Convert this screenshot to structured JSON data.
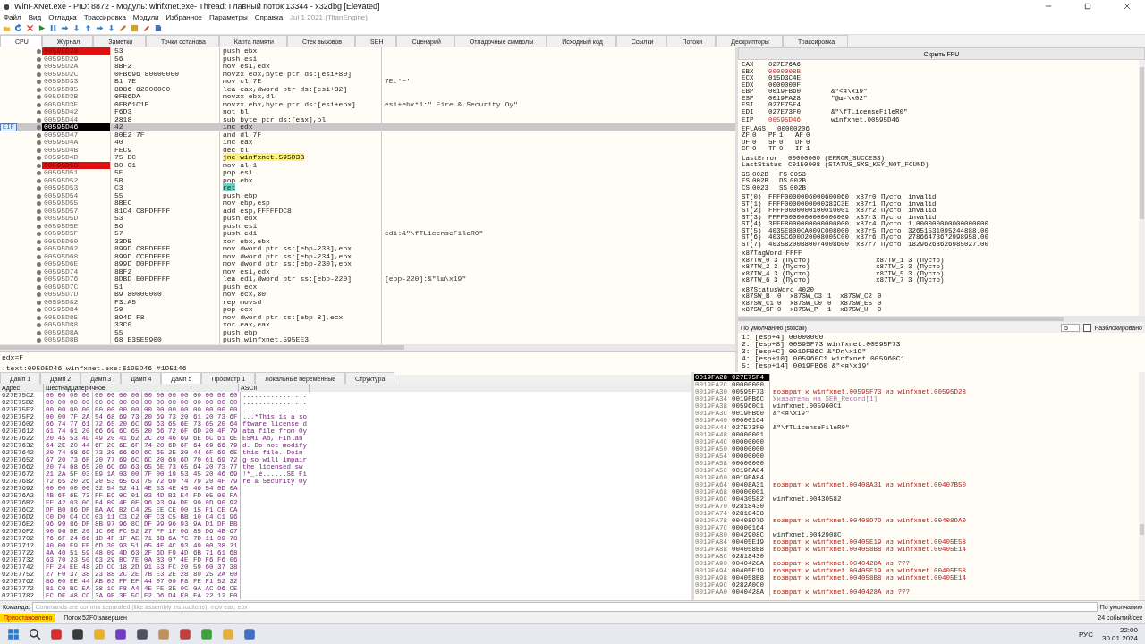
{
  "window": {
    "title": "WinFXNet.exe - PID: 8872 - Модуль: winfxnet.exe- Thread: Главный поток 13344 - x32dbg [Elevated]"
  },
  "menu": [
    "Файл",
    "Вид",
    "Отладка",
    "Трассировка",
    "Модули",
    "Избранное",
    "Параметры",
    "Справка"
  ],
  "build_info": "Jul 1 2021 (TitanEngine)",
  "tabs": [
    {
      "label": "CPU",
      "selected": true
    },
    {
      "label": "Журнал",
      "selected": false
    },
    {
      "label": "Заметки",
      "selected": false
    },
    {
      "label": "Точки останова",
      "selected": false
    },
    {
      "label": "Карта памяти",
      "selected": false
    },
    {
      "label": "Стек вызовов",
      "selected": false
    },
    {
      "label": "SEH",
      "selected": false
    },
    {
      "label": "Сценарий",
      "selected": false
    },
    {
      "label": "Отладочные символы",
      "selected": false
    },
    {
      "label": "Исходный код",
      "selected": false
    },
    {
      "label": "Ссылки",
      "selected": false
    },
    {
      "label": "Потоки",
      "selected": false
    },
    {
      "label": "Дескрипторы",
      "selected": false
    },
    {
      "label": "Трассировка",
      "selected": false
    }
  ],
  "disassembly": {
    "eip_label": "EIP",
    "rows": [
      {
        "address": "00595D28",
        "bytes": "53",
        "instruction": "push ebx",
        "breakpoint": true,
        "current": false,
        "kind": "plain"
      },
      {
        "address": "00595D29",
        "bytes": "56",
        "instruction": "push esi",
        "breakpoint": false,
        "current": false,
        "kind": "plain"
      },
      {
        "address": "00595D2A",
        "bytes": "8BF2",
        "instruction": "mov esi,edx",
        "breakpoint": false,
        "current": false,
        "kind": "plain"
      },
      {
        "address": "00595D2C",
        "bytes": "0FB696 80000000",
        "instruction": "movzx edx,byte ptr ds:[esi+80]",
        "breakpoint": false,
        "current": false,
        "kind": "plain"
      },
      {
        "address": "00595D33",
        "bytes": "B1 7E",
        "instruction": "mov cl,7E",
        "comment": "7E:'~'",
        "breakpoint": false,
        "current": false,
        "kind": "plain"
      },
      {
        "address": "00595D35",
        "bytes": "8D86 82000000",
        "instruction": "lea eax,dword ptr ds:[esi+82]",
        "breakpoint": false,
        "current": false,
        "kind": "plain"
      },
      {
        "address": "00595D3B",
        "bytes": "0FB6DA",
        "instruction": "movzx ebx,dl",
        "breakpoint": false,
        "current": false,
        "kind": "plain"
      },
      {
        "address": "00595D3E",
        "bytes": "0FB61C1E",
        "instruction": "movzx ebx,byte ptr ds:[esi+ebx]",
        "comment": "esi+ebx*1:\" Fire & Security Oy\"",
        "breakpoint": false,
        "current": false,
        "kind": "plain"
      },
      {
        "address": "00595D42",
        "bytes": "F6D3",
        "instruction": "not bl",
        "breakpoint": false,
        "current": false,
        "kind": "plain"
      },
      {
        "address": "00595D44",
        "bytes": "2818",
        "instruction": "sub byte ptr ds:[eax],bl",
        "breakpoint": false,
        "current": false,
        "kind": "plain"
      },
      {
        "address": "00595D46",
        "bytes": "42",
        "instruction": "inc edx",
        "breakpoint": false,
        "current": true,
        "kind": "plain"
      },
      {
        "address": "00595D47",
        "bytes": "80E2 7F",
        "instruction": "and dl,7F",
        "breakpoint": false,
        "current": false,
        "kind": "plain"
      },
      {
        "address": "00595D4A",
        "bytes": "40",
        "instruction": "inc eax",
        "breakpoint": false,
        "current": false,
        "kind": "plain"
      },
      {
        "address": "00595D4B",
        "bytes": "FEC9",
        "instruction": "dec cl",
        "breakpoint": false,
        "current": false,
        "kind": "plain"
      },
      {
        "address": "00595D4D",
        "bytes": "75 EC",
        "instruction": "jne winfxnet.595D3B",
        "breakpoint": false,
        "current": false,
        "kind": "jump"
      },
      {
        "address": "00595D50",
        "bytes": "B0 01",
        "instruction": "mov al,1",
        "breakpoint": true,
        "current": false,
        "kind": "plain"
      },
      {
        "address": "00595D51",
        "bytes": "5E",
        "instruction": "pop esi",
        "breakpoint": false,
        "current": false,
        "kind": "plain"
      },
      {
        "address": "00595D52",
        "bytes": "5B",
        "instruction": "pop ebx",
        "breakpoint": false,
        "current": false,
        "kind": "plain"
      },
      {
        "address": "00595D53",
        "bytes": "C3",
        "instruction": "ret",
        "breakpoint": false,
        "current": false,
        "kind": "ret"
      },
      {
        "address": "00595D54",
        "bytes": "55",
        "instruction": "push ebp",
        "breakpoint": false,
        "current": false,
        "kind": "plain"
      },
      {
        "address": "00595D55",
        "bytes": "8BEC",
        "instruction": "mov ebp,esp",
        "breakpoint": false,
        "current": false,
        "kind": "plain"
      },
      {
        "address": "00595D57",
        "bytes": "81C4 C8FDFFFF",
        "instruction": "add esp,FFFFFDC8",
        "breakpoint": false,
        "current": false,
        "kind": "plain"
      },
      {
        "address": "00595D5D",
        "bytes": "53",
        "instruction": "push ebx",
        "breakpoint": false,
        "current": false,
        "kind": "plain"
      },
      {
        "address": "00595D5E",
        "bytes": "56",
        "instruction": "push esi",
        "breakpoint": false,
        "current": false,
        "kind": "plain"
      },
      {
        "address": "00595D5F",
        "bytes": "57",
        "instruction": "push edi",
        "comment": "edi:&\"\\fTLicenseFileR0\"",
        "breakpoint": false,
        "current": false,
        "kind": "plain"
      },
      {
        "address": "00595D60",
        "bytes": "33DB",
        "instruction": "xor ebx,ebx",
        "breakpoint": false,
        "current": false,
        "kind": "plain"
      },
      {
        "address": "00595D62",
        "bytes": "899D C8FDFFFF",
        "instruction": "mov dword ptr ss:[ebp-238],ebx",
        "breakpoint": false,
        "current": false,
        "kind": "plain"
      },
      {
        "address": "00595D68",
        "bytes": "899D CCFDFFFF",
        "instruction": "mov dword ptr ss:[ebp-234],ebx",
        "breakpoint": false,
        "current": false,
        "kind": "plain"
      },
      {
        "address": "00595D6E",
        "bytes": "899D D0FDFFFF",
        "instruction": "mov dword ptr ss:[ebp-230],ebx",
        "breakpoint": false,
        "current": false,
        "kind": "plain"
      },
      {
        "address": "00595D74",
        "bytes": "8BF2",
        "instruction": "mov esi,edx",
        "breakpoint": false,
        "current": false,
        "kind": "plain"
      },
      {
        "address": "00595D76",
        "bytes": "8DBD E0FDFFFF",
        "instruction": "lea edi,dword ptr ss:[ebp-220]",
        "comment": "[ebp-220]:&\"lш\\x19\"",
        "breakpoint": false,
        "current": false,
        "kind": "plain"
      },
      {
        "address": "00595D7C",
        "bytes": "51",
        "instruction": "push ecx",
        "breakpoint": false,
        "current": false,
        "kind": "plain"
      },
      {
        "address": "00595D7D",
        "bytes": "B9 80000000",
        "instruction": "mov ecx,80",
        "breakpoint": false,
        "current": false,
        "kind": "plain"
      },
      {
        "address": "00595D82",
        "bytes": "F3:A5",
        "instruction": "rep movsd",
        "breakpoint": false,
        "current": false,
        "kind": "plain"
      },
      {
        "address": "00595D84",
        "bytes": "59",
        "instruction": "pop ecx",
        "breakpoint": false,
        "current": false,
        "kind": "plain"
      },
      {
        "address": "00595D85",
        "bytes": "894D F8",
        "instruction": "mov dword ptr ss:[ebp-8],ecx",
        "breakpoint": false,
        "current": false,
        "kind": "plain"
      },
      {
        "address": "00595D88",
        "bytes": "33C0",
        "instruction": "xor eax,eax",
        "breakpoint": false,
        "current": false,
        "kind": "plain"
      },
      {
        "address": "00595D8A",
        "bytes": "55",
        "instruction": "push ebp",
        "breakpoint": false,
        "current": false,
        "kind": "plain"
      },
      {
        "address": "00595D8B",
        "bytes": "68 E35E5900",
        "instruction": "push winfxnet.595EE3",
        "breakpoint": false,
        "current": false,
        "kind": "plain"
      }
    ]
  },
  "info_lines": [
    "edx=F",
    ".text:00595D46 winfxnet.exe:$195D46 #195146"
  ],
  "registers": {
    "hide_fpu": "Скрыть FPU",
    "general": [
      {
        "name": "EAX",
        "value": "027E76A6",
        "changed": false
      },
      {
        "name": "EBX",
        "value": "0000008B",
        "changed": true
      },
      {
        "name": "ECX",
        "value": "015D3C4E",
        "changed": false
      },
      {
        "name": "EDX",
        "value": "0000000F",
        "changed": false
      },
      {
        "name": "EBP",
        "value": "0019FB60",
        "comment": "&\"<я\\x19\"",
        "changed": false
      },
      {
        "name": "ESP",
        "value": "0019FA28",
        "comment": "\"@ш-\\x02\"",
        "changed": false
      },
      {
        "name": "ESI",
        "value": "027E75F4",
        "changed": false
      },
      {
        "name": "EDI",
        "value": "027E73F0",
        "comment": "&\"\\fTLicenseFileR0\"",
        "changed": false
      }
    ],
    "eip": {
      "name": "EIP",
      "value": "00595D46",
      "comment": "winfxnet.00595D46",
      "changed": true
    },
    "blocks": [
      {
        "kind": "flags",
        "lines": [
          [
            "EFLAGS",
            "00000206"
          ],
          [
            "ZF",
            "0",
            "PF",
            "1",
            "AF",
            "0"
          ],
          [
            "OF",
            "0",
            "SF",
            "0",
            "DF",
            "0"
          ],
          [
            "CF",
            "0",
            "TF",
            "0",
            "IF",
            "1"
          ]
        ]
      },
      {
        "kind": "error",
        "lines": [
          [
            "LastError",
            "00000000 (ERROR_SUCCESS)"
          ],
          [
            "LastStatus",
            "C0150008 (STATUS_SXS_KEY_NOT_FOUND)"
          ]
        ]
      },
      {
        "kind": "segments",
        "lines": [
          [
            "GS",
            "002B",
            "FS",
            "0053"
          ],
          [
            "ES",
            "002B",
            "DS",
            "002B"
          ],
          [
            "CS",
            "0023",
            "SS",
            "002B"
          ]
        ]
      },
      {
        "kind": "fpu",
        "lines": [
          [
            "ST(0)",
            "FFFF0000006000600060",
            "x87r0",
            "Пусто",
            "invalid"
          ],
          [
            "ST(1)",
            "FFFF0000000000383C3E",
            "x87r1",
            "Пусто",
            "invalid"
          ],
          [
            "ST(2)",
            "FFFF0000000100010001",
            "x87r2",
            "Пусто",
            "invalid"
          ],
          [
            "ST(3)",
            "FFFF0000000000000009",
            "x87r3",
            "Пусто",
            "invalid"
          ],
          [
            "ST(4)",
            "3FFF8000000000000000",
            "x87r4",
            "Пусто",
            "1.000000000000000000"
          ],
          [
            "ST(5)",
            "4035E800CA009C008000",
            "x87r5",
            "Пусто",
            "32651531095244888.00"
          ],
          [
            "ST(6)",
            "4035C600D20008005C00",
            "x87r6",
            "Пусто",
            "27866473672998958.00"
          ],
          [
            "ST(7)",
            "40358200B80074008600",
            "x87r7",
            "Пусто",
            "18296268626985027.00"
          ]
        ]
      },
      {
        "kind": "tags",
        "lines": [
          [
            "x87TagWord FFFF"
          ],
          [
            "x87TW_0 3 (Пусто)",
            "x87TW_1 3 (Пусто)"
          ],
          [
            "x87TW_2 3 (Пусто)",
            "x87TW_3 3 (Пусто)"
          ],
          [
            "x87TW_4 3 (Пусто)",
            "x87TW_5 3 (Пусто)"
          ],
          [
            "x87TW_6 3 (Пусто)",
            "x87TW_7 3 (Пусто)"
          ]
        ]
      },
      {
        "kind": "status",
        "lines": [
          [
            "x87StatusWord 4020"
          ],
          [
            "x87SW_B",
            "0",
            "x87SW_C3",
            "1",
            "x87SW_C2",
            "0"
          ],
          [
            "x87SW_C1",
            "0",
            "x87SW_C0",
            "0",
            "x87SW_ES",
            "0"
          ],
          [
            "x87SW_SF",
            "0",
            "x87SW_P",
            "1",
            "x87SW_U",
            "0"
          ]
        ]
      }
    ]
  },
  "call_args": {
    "convention": "По умолчанию (stdcall)",
    "count": "5",
    "unlock": {
      "label": "Разблокировано",
      "checked": false
    },
    "lines": [
      "1: [esp+4] 00000000",
      "2: [esp+8] 00595F73 winfxnet.00595F73",
      "3: [esp+C] 0019FB6C &\"Dя\\x19\"",
      "4: [esp+10] 005960C1 winfxnet.005960C1",
      "5: [esp+14] 0019FB60 &\"<я\\x19\""
    ]
  },
  "dump_tabs": [
    {
      "label": "Дамп 1",
      "selected": false
    },
    {
      "label": "Дамп 2",
      "selected": false
    },
    {
      "label": "Дамп 3",
      "selected": false
    },
    {
      "label": "Дамп 4",
      "selected": false
    },
    {
      "label": "Дамп 5",
      "selected": true
    },
    {
      "label": "Просмотр 1",
      "selected": false
    },
    {
      "label": "Локальные переменные",
      "selected": false
    },
    {
      "label": "Структура",
      "selected": false
    }
  ],
  "dump": {
    "columns": [
      "Адрес",
      "Шестнадцатеричное",
      "ASCII"
    ],
    "rows": [
      {
        "address": "027E75C2",
        "hex": [
          "00 00 00 00",
          "00 00 00 00",
          "00 00 00 00",
          "00 00 00 00"
        ],
        "ascii": "................"
      },
      {
        "address": "027E75D2",
        "hex": [
          "00 00 00 00",
          "00 00 00 00",
          "00 00 00 00",
          "00 00 00 00"
        ],
        "ascii": "................"
      },
      {
        "address": "027E75E2",
        "hex": [
          "00 00 00 00",
          "00 00 00 00",
          "00 00 00 00",
          "00 00 00 00"
        ],
        "ascii": "................"
      },
      {
        "address": "027E75F2",
        "hex": [
          "00 00 7F 2A",
          "54 68 69 73",
          "20 69 73 20",
          "61 20 73 6F"
        ],
        "ascii": "...*This is a so"
      },
      {
        "address": "027E7602",
        "hex": [
          "66 74 77 61",
          "72 65 20 6C",
          "69 63 65 6E",
          "73 65 20 64"
        ],
        "ascii": "ftware license d"
      },
      {
        "address": "027E7612",
        "hex": [
          "61 74 61 20",
          "66 69 6C 65",
          "20 66 72 6F",
          "6D 20 4F 79"
        ],
        "ascii": "ata file from Oy"
      },
      {
        "address": "027E7622",
        "hex": [
          "20 45 53 4D",
          "49 20 41 62",
          "2C 20 46 69",
          "6E 6C 61 6E"
        ],
        "ascii": " ESMI Ab, Finlan"
      },
      {
        "address": "027E7632",
        "hex": [
          "64 2E 20 44",
          "6F 20 6E 6F",
          "74 20 6D 6F",
          "64 69 66 79"
        ],
        "ascii": "d. Do not modify"
      },
      {
        "address": "027E7642",
        "hex": [
          "20 74 68 69",
          "73 20 66 69",
          "6C 65 2E 20",
          "44 6F 69 6E"
        ],
        "ascii": " this file. Doin"
      },
      {
        "address": "027E7652",
        "hex": [
          "67 20 73 6F",
          "20 77 69 6C",
          "6C 20 69 6D",
          "70 61 69 72"
        ],
        "ascii": "g so will impair"
      },
      {
        "address": "027E7662",
        "hex": [
          "20 74 68 65",
          "20 6C 69 63",
          "65 6E 73 65",
          "64 20 73 77"
        ],
        "ascii": " the licensed sw"
      },
      {
        "address": "027E7672",
        "hex": [
          "21 2A 5F 03",
          "E9 1A 03 00",
          "7F 00 19 53",
          "45 20 46 69"
        ],
        "ascii": "!*_.é......SE Fi"
      },
      {
        "address": "027E7682",
        "hex": [
          "72 65 20 26",
          "20 53 65 63",
          "75 72 69 74",
          "79 20 4F 79"
        ],
        "ascii": "re & Security Oy"
      },
      {
        "address": "027E7692",
        "hex": [
          "00 00 00 00",
          "32 54 52 41",
          "4E 53 4E 45",
          "46 54 0D 0A"
        ]
      },
      {
        "address": "027E76A2",
        "hex": [
          "4B 6F 6E 73",
          "FF E9 0C 01",
          "03 4D B3 E4",
          "FD 05 00 FA"
        ]
      },
      {
        "address": "027E76B2",
        "hex": [
          "FF 42 03 0C",
          "F4 09 4E 0F",
          "96 93 9A DF",
          "99 8D 90 92"
        ]
      },
      {
        "address": "027E76C2",
        "hex": [
          "DF B0 86 DF",
          "BA AC B2 C4",
          "25 EE CE 00",
          "15 F1 CE CA"
        ]
      },
      {
        "address": "027E76D2",
        "hex": [
          "C0 D0 C4 CC",
          "03 11 C3 C2",
          "0F C3 C5 BB",
          "10 C4 C1 96"
        ]
      },
      {
        "address": "027E76E2",
        "hex": [
          "96 99 86 DF",
          "8B 97 96 8C",
          "DF 99 96 93",
          "9A D1 DF BB"
        ]
      },
      {
        "address": "027E76F2",
        "hex": [
          "90 96 DE 20",
          "1C 0E FC 52",
          "27 FF 1F 06",
          "85 D6 4B 67"
        ]
      },
      {
        "address": "027E7702",
        "hex": [
          "76 6F 24 66",
          "1D 4F 1F AE",
          "71 6B 6A 7C",
          "7D 11 09 78"
        ]
      },
      {
        "address": "027E7712",
        "hex": [
          "40 00 E9 FE",
          "6D 30 93 51",
          "05 4F 4C 93",
          "49 00 38 21"
        ]
      },
      {
        "address": "027E7722",
        "hex": [
          "4A 40 51 59",
          "48 09 4D 63",
          "2F 6D F9 4D",
          "6B 71 61 68"
        ]
      },
      {
        "address": "027E7732",
        "hex": [
          "63 70 23 50",
          "63 29 BC 7E",
          "0A B3 07 4E",
          "FD F6 F6 06"
        ]
      },
      {
        "address": "027E7742",
        "hex": [
          "FF 24 EE 48",
          "2D CC 18 2D",
          "91 53 FC 20",
          "59 60 37 38"
        ]
      },
      {
        "address": "027E7752",
        "hex": [
          "27 F0 37 38",
          "23 88 2C 2E",
          "7B E3 2E 28",
          "80 25 2A 00"
        ]
      },
      {
        "address": "027E7762",
        "hex": [
          "B6 00 EE 44",
          "AB 03 FF EF",
          "44 07 09 F8",
          "FE F1 52 32"
        ]
      },
      {
        "address": "027E7772",
        "hex": [
          "B1 C0 BC 5A",
          "38 1C F8 A4",
          "4E FE 3E 0C",
          "0A AC 96 CE"
        ]
      },
      {
        "address": "027E7782",
        "hex": [
          "EC DE 48 CC",
          "3A 9E 3E 5C",
          "E2 D6 D4 F8",
          "FA 22 12 F0"
        ]
      }
    ]
  },
  "stack": [
    {
      "address": "0019FA28",
      "value": "027E75F4",
      "selected": true
    },
    {
      "address": "0019FA2C",
      "value": "00000000",
      "selected": false
    },
    {
      "address": "0019FA30",
      "value": "00595F73",
      "comment": "возврат к winfxnet.00595F73 из winfxnet.00595D28",
      "kind": "return",
      "selected": false
    },
    {
      "address": "0019FA34",
      "value": "0019FB6C",
      "comment": "Указатель на SEH_Record[1]",
      "kind": "seh",
      "selected": false
    },
    {
      "address": "0019FA38",
      "value": "005960C1",
      "comment": "winfxnet.005960C1",
      "kind": "plain",
      "selected": false
    },
    {
      "address": "0019FA3C",
      "value": "0019FB60",
      "comment": "&\"<я\\x19\"",
      "kind": "plain",
      "selected": false
    },
    {
      "address": "0019FA40",
      "value": "00000164",
      "selected": false
    },
    {
      "address": "0019FA44",
      "value": "027E73F0",
      "comment": "&\"\\fTLicenseFileR0\"",
      "kind": "plain",
      "selected": false
    },
    {
      "address": "0019FA48",
      "value": "00000001",
      "selected": false
    },
    {
      "address": "0019FA4C",
      "value": "00000000",
      "selected": false
    },
    {
      "address": "0019FA50",
      "value": "00000000",
      "selected": false
    },
    {
      "address": "0019FA54",
      "value": "00000000",
      "selected": false
    },
    {
      "address": "0019FA58",
      "value": "00000000",
      "selected": false
    },
    {
      "address": "0019FA5C",
      "value": "0019FA84",
      "selected": false
    },
    {
      "address": "0019FA60",
      "value": "0019FA84",
      "selected": false
    },
    {
      "address": "0019FA64",
      "value": "00408A31",
      "comment": "возврат к winfxnet.00408A31 из winfxnet.00407B50",
      "kind": "return",
      "selected": false
    },
    {
      "address": "0019FA68",
      "value": "00000001",
      "selected": false
    },
    {
      "address": "0019FA6C",
      "value": "00430582",
      "comment": "winfxnet.00430582",
      "kind": "plain",
      "selected": false
    },
    {
      "address": "0019FA70",
      "value": "02818430",
      "selected": false
    },
    {
      "address": "0019FA74",
      "value": "02818438",
      "selected": false
    },
    {
      "address": "0019FA78",
      "value": "00408979",
      "comment": "возврат к winfxnet.00408979 из winfxnet.004089A0",
      "kind": "return",
      "selected": false
    },
    {
      "address": "0019FA7C",
      "value": "00000164",
      "selected": false
    },
    {
      "address": "0019FA80",
      "value": "0042908C",
      "comment": "winfxnet.0042908C",
      "kind": "plain",
      "selected": false
    },
    {
      "address": "0019FA84",
      "value": "00405E19",
      "comment": "возврат к winfxnet.00405E19 из winfxnet.00405E58",
      "kind": "return",
      "selected": false
    },
    {
      "address": "0019FA88",
      "value": "004058B8",
      "comment": "возврат к winfxnet.004058B8 из winfxnet.00405E14",
      "kind": "return",
      "selected": false
    },
    {
      "address": "0019FA8C",
      "value": "02818430",
      "selected": false
    },
    {
      "address": "0019FA90",
      "value": "0040428A",
      "comment": "возврат к winfxnet.0040428A из ???",
      "kind": "return",
      "selected": false
    },
    {
      "address": "0019FA94",
      "value": "00405E19",
      "comment": "возврат к winfxnet.00405E19 из winfxnet.00405E58",
      "kind": "return",
      "selected": false
    },
    {
      "address": "0019FA98",
      "value": "004058B8",
      "comment": "возврат к winfxnet.004058B8 из winfxnet.00405E14",
      "kind": "return",
      "selected": false
    },
    {
      "address": "0019FA9C",
      "value": "0282A0C0",
      "selected": false
    },
    {
      "address": "0019FAA0",
      "value": "0040428A",
      "comment": "возврат к winfxnet.0040428A из ???",
      "kind": "return",
      "selected": false
    }
  ],
  "command": {
    "label": "Команда:",
    "placeholder": "Commands are comma separated (like assembly instructions): mov eax, ebx",
    "mode": "По умолчанию"
  },
  "status": {
    "state": "Приостановлено",
    "message": "Поток 52F0 завершен",
    "events": "24 событий/сек"
  },
  "taskbar": {
    "lang": "РУС",
    "time": "22:00",
    "date": "30.01.2024"
  }
}
